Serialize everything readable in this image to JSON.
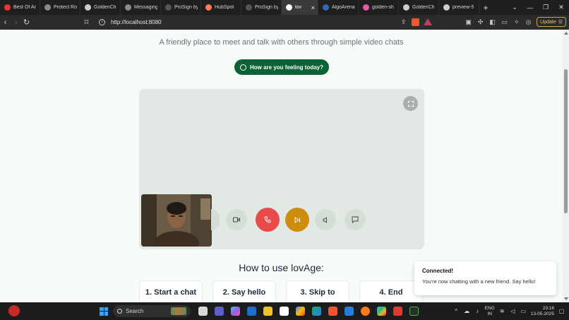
{
  "browser": {
    "tabs": [
      {
        "title": "Best Of Ar",
        "fav_color": "#e53935"
      },
      {
        "title": "Protect Ro",
        "fav_color": "#8a8a8a"
      },
      {
        "title": "GoldenCh",
        "fav_color": "#cccccc"
      },
      {
        "title": "Messaging",
        "fav_color": "#8a8a8a"
      },
      {
        "title": "ProSign by",
        "fav_color": "#555555"
      },
      {
        "title": "HubSpot",
        "fav_color": "#ff7a59"
      },
      {
        "title": "ProSign by",
        "fav_color": "#555555"
      },
      {
        "title": "lov",
        "fav_color": "#ffffff",
        "active": true
      },
      {
        "title": "AlgoArena",
        "fav_color": "#2b6cb0"
      },
      {
        "title": "golden-sh",
        "fav_color": "#e35ba6"
      },
      {
        "title": "GoldenCh",
        "fav_color": "#cccccc"
      },
      {
        "title": "preview-5",
        "fav_color": "#cccccc"
      }
    ],
    "url": "http://localhost:8080",
    "update_label": "Update"
  },
  "page": {
    "subtitle": "A friendly place to meet and talk with others through simple video chats",
    "mood_button": "How are you feeling today?",
    "howto_title": "How to use lovAge:",
    "steps": [
      "1. Start a chat",
      "2. Say hello",
      "3. Skip to",
      "4. End"
    ]
  },
  "toast": {
    "title": "Connected!",
    "message": "You're now chatting with a new friend. Say hello!"
  },
  "taskbar": {
    "search_placeholder": "Search",
    "lang_line1": "ENG",
    "lang_line2": "IN",
    "time": "23:16",
    "date": "13-05-2025"
  },
  "colors": {
    "brand_green": "#0c6136",
    "end_call_red": "#ea4a4a",
    "skip_gold": "#cf8d0e",
    "control_light": "#d3ded6"
  }
}
